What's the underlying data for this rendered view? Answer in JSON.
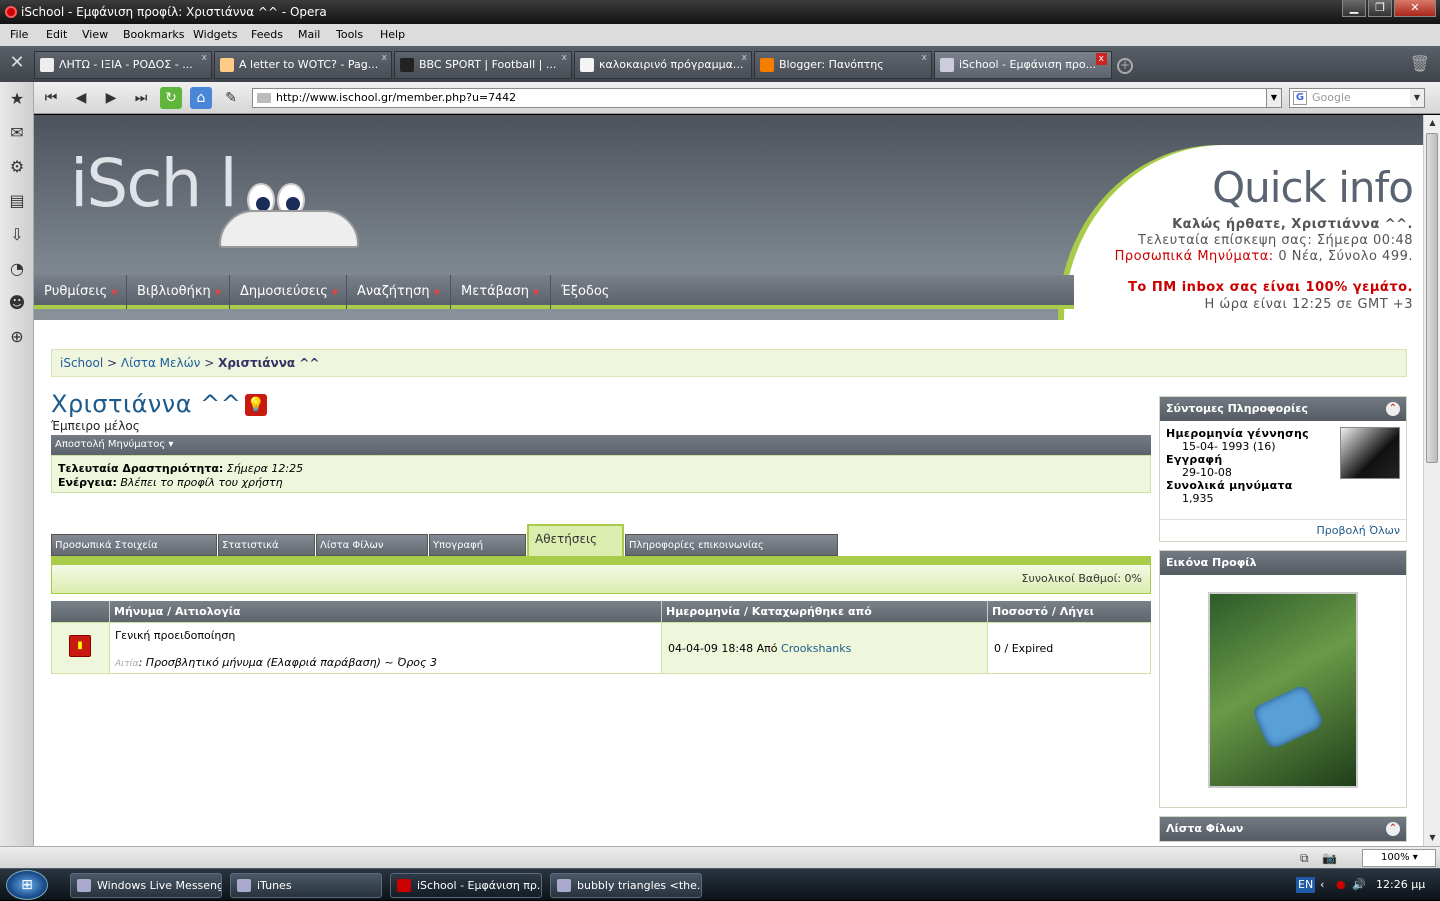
{
  "window": {
    "title": "iSchool - Εμφάνιση προφίλ: Χριστιάννα ^^ - Opera",
    "btn_min": "▁",
    "btn_max": "❐",
    "btn_close": "✕"
  },
  "menu": [
    "File",
    "Edit",
    "View",
    "Bookmarks",
    "Widgets",
    "Feeds",
    "Mail",
    "Tools",
    "Help"
  ],
  "tabs": [
    {
      "label": "ΛΗΤΩ - ΙΞΙΑ - ΡΟΔΟΣ - ...",
      "color": "#e8e8e8"
    },
    {
      "label": "A letter to WOTC? - Pag...",
      "color": "#fc8"
    },
    {
      "label": "BBC SPORT | Football | ...",
      "color": "#222"
    },
    {
      "label": "καλοκαιρινό πρόγραμμα...",
      "color": "#f4f4f4"
    },
    {
      "label": "Blogger: Πανόπτης",
      "color": "#f57d00"
    },
    {
      "label": "iSchool - Εμφάνιση προ...",
      "color": "#ccd"
    }
  ],
  "tab_close": "x",
  "address": "http://www.ischool.gr/member.php?u=7442",
  "search": {
    "engine_letter": "G",
    "placeholder": "Google"
  },
  "header": {
    "logo": "iSch  l",
    "qi_title": "Quick info",
    "welcome": "Καλώς ήρθατε, Χριστιάννα ^^.",
    "last_visit": "Τελευταία επίσκεψη σας: Σήμερα 00:48",
    "pm_label": "Προσωπικά Μηνύματα:",
    "pm_value": "0 Νέα, Σύνολο 499.",
    "inbox_full": "Το ΠΜ inbox σας είναι 100% γεμάτο.",
    "time": "Η ώρα είναι 12:25 σε GMT +3"
  },
  "mainnav": [
    "Ρυθμίσεις",
    "Βιβλιοθήκη",
    "Δημοσιεύσεις",
    "Αναζήτηση",
    "Μετάβαση",
    "Έξοδος"
  ],
  "breadcrumb": {
    "home": "iSchool",
    "list": "Λίστα Μελών",
    "current": "Χριστιάννα ^^"
  },
  "profile": {
    "username": "Χριστιάννα ^^",
    "rank": "Έμπειρο μέλος",
    "send_pm": "Αποστολή Μηνύματος",
    "last_activity_label": "Τελευταία Δραστηριότητα:",
    "last_activity_value": "Σήμερα 12:25",
    "action_label": "Ενέργεια:",
    "action_value": "Βλέπει το προφίλ του χρήστη"
  },
  "ptabs": [
    "Προσωπικά Στοιχεία",
    "Στατιστικά",
    "Λίστα Φίλων",
    "Υπογραφή",
    "Αθετήσεις",
    "Πληροφορίες επικοινωνίας"
  ],
  "infractions": {
    "total": "Συνολικοί Βαθμοί: 0%",
    "col_msg": "Μήνυμα / Αιτιολογία",
    "col_date": "Ημερομηνία / Καταχωρήθηκε από",
    "col_pct": "Ποσοστό / Λήγει",
    "row": {
      "title": "Γενική προειδοποίηση",
      "reason_label": "Αιτία",
      "reason": ": Προσβλητικό μήνυμα (Ελαφριά παράβαση) ~ Όρος 3",
      "date": "04-04-09 18:48 Από",
      "by": "Crookshanks",
      "pct": "0 / Expired"
    }
  },
  "sidebar": {
    "quick_title": "Σύντομες Πληροφορίες",
    "birth_label": "Ημερομηνία γέννησης",
    "birth": "15-04- 1993 (16)",
    "reg_label": "Εγγραφή",
    "reg": "29-10-08",
    "posts_label": "Συνολικά μηνύματα",
    "posts": "1,935",
    "view_all": "Προβολή Όλων",
    "pic_title": "Εικόνα Προφίλ",
    "friends_title": "Λίστα Φίλων"
  },
  "zoom": "100%",
  "taskbar": {
    "tasks": [
      "Windows Live Messenger",
      "iTunes",
      "iSchool - Εμφάνιση πρ...",
      "bubbly triangles <the..."
    ],
    "lang": "EN",
    "clock": "12:26 μμ"
  }
}
